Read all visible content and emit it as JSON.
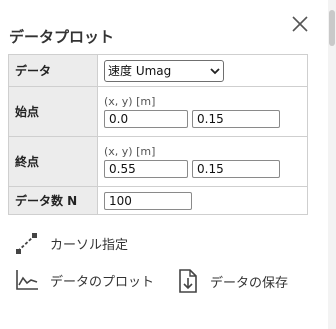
{
  "panel": {
    "title": "データプロット",
    "close_icon": "close-icon"
  },
  "form": {
    "data_label": "データ",
    "data_select_value": "速度 Umag",
    "start_label": "始点",
    "start_hint": "(x, y) [m]",
    "start_x": "0.0",
    "start_y": "0.15",
    "end_label": "終点",
    "end_hint": "(x, y) [m]",
    "end_x": "0.55",
    "end_y": "0.15",
    "count_label": "データ数 N",
    "count_value": "100"
  },
  "actions": {
    "cursor_label": "カーソル指定",
    "plot_label": "データのプロット",
    "save_label": "データの保存",
    "icons": [
      "cursor-line-icon",
      "line-chart-icon",
      "download-file-icon"
    ]
  },
  "colors": {
    "label_bg": "#ececec",
    "border": "#cfcfcf",
    "icon": "#444444"
  }
}
